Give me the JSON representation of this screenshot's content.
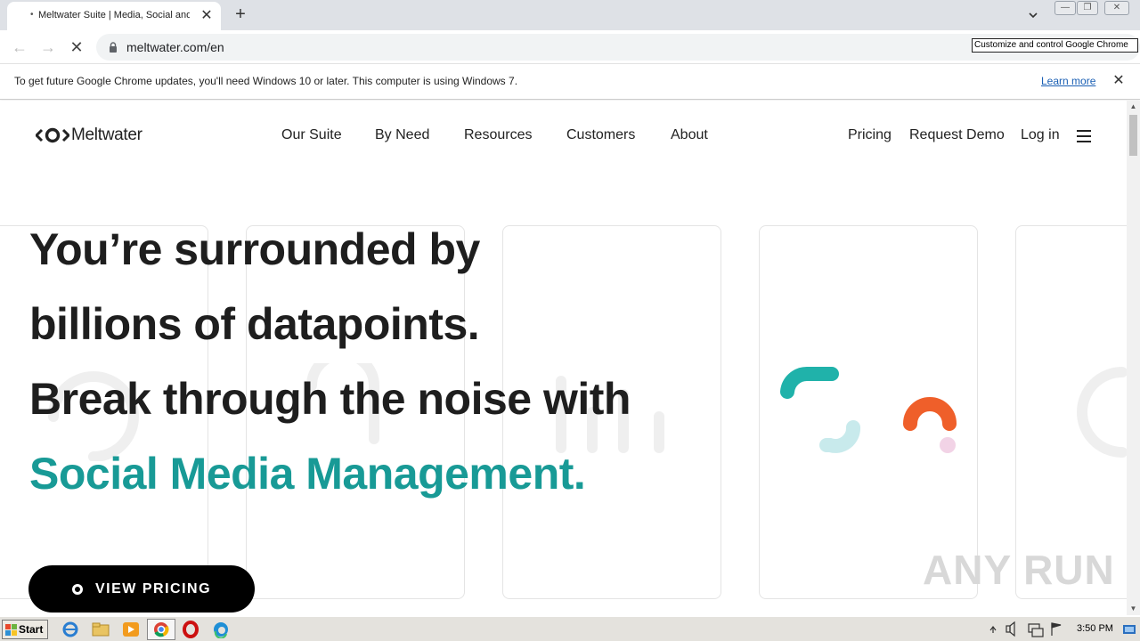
{
  "browser": {
    "tab_title": "Meltwater Suite | Media, Social and Consumer Intelligence",
    "tab_favicon": "•",
    "new_tab_symbol": "+",
    "url": "meltwater.com/en",
    "tooltip": "Customize and control Google Chrome"
  },
  "infobar": {
    "message": "To get future Google Chrome updates, you'll need Windows 10 or later. This computer is using Windows 7.",
    "link": "Learn more"
  },
  "site": {
    "logo_text": "Meltwater",
    "nav": [
      "Our Suite",
      "By Need",
      "Resources",
      "Customers",
      "About"
    ],
    "right_nav": [
      "Pricing",
      "Request Demo",
      "Log in"
    ],
    "headline": [
      "You’re surrounded by",
      "billions of datapoints.",
      "Break through the noise with"
    ],
    "highlight": "Social Media Management.",
    "cta": "VIEW PRICING"
  },
  "watermark": "ANY RUN",
  "taskbar": {
    "start": "Start",
    "time": "3:50 PM"
  },
  "colors": {
    "teal": "#189a96",
    "orange": "#ef5f2a",
    "light_teal": "#bfe5e8",
    "pink": "#f2d3e6"
  }
}
